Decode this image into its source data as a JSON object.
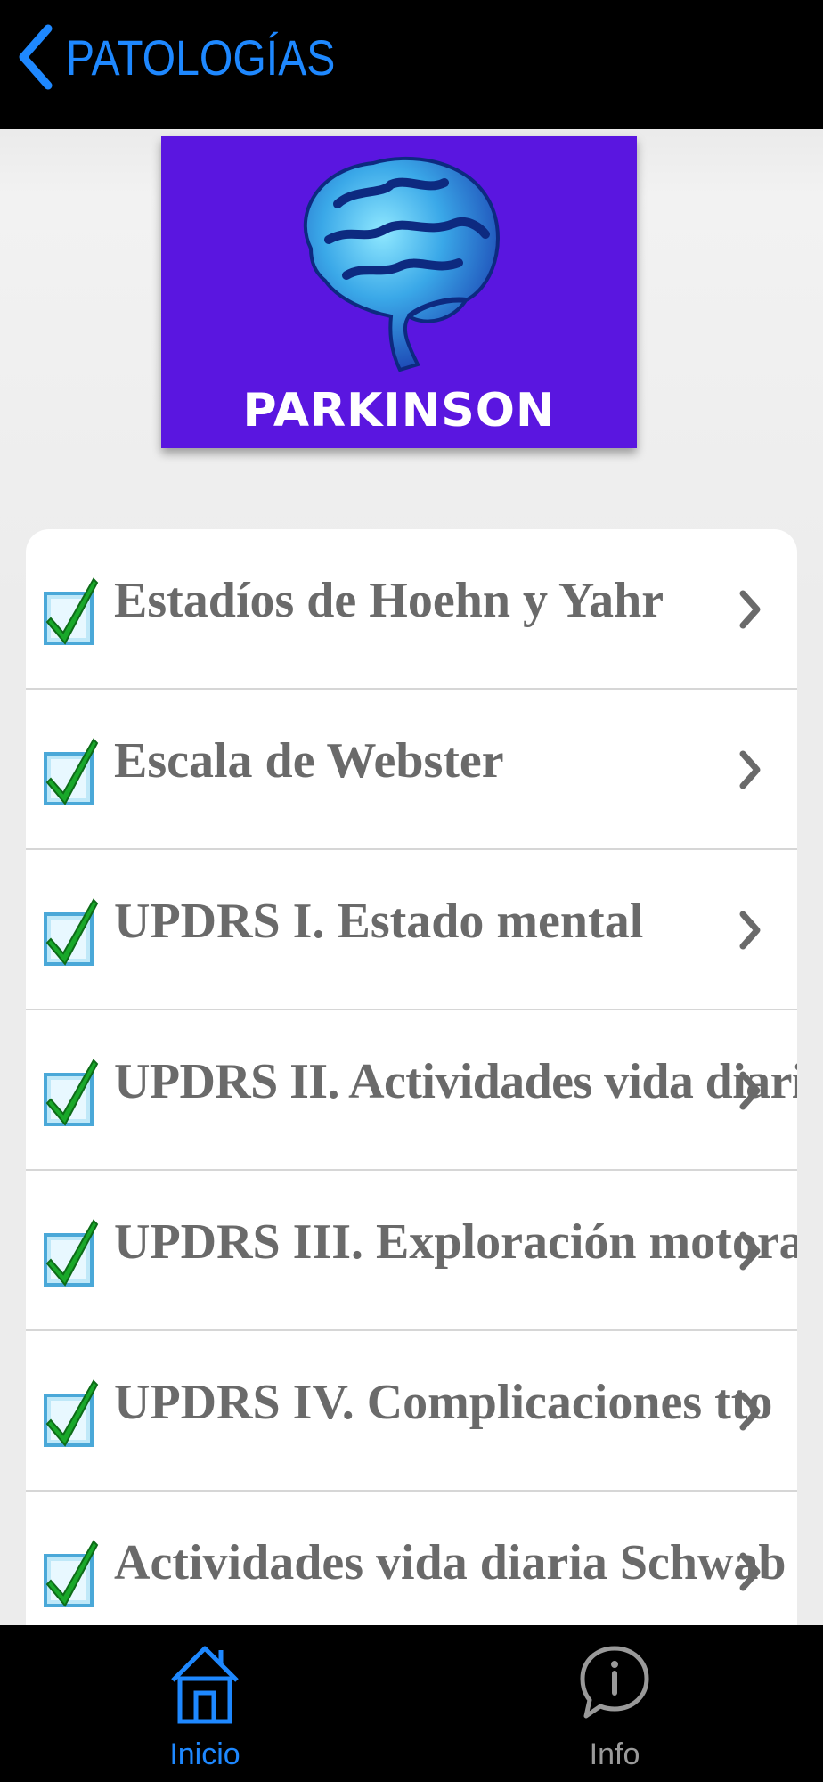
{
  "navbar": {
    "back_label": "PATOLOGÍAS",
    "accent_color": "#1e88ff",
    "background_color": "#000000"
  },
  "banner": {
    "title": "PARKINSON",
    "background_color": "#5a16e0",
    "icon": "brain-icon"
  },
  "list": {
    "items": [
      {
        "label": "Estadíos de Hoehn y Yahr",
        "icon": "checkbox-checked-icon"
      },
      {
        "label": "Escala de Webster",
        "icon": "checkbox-checked-icon"
      },
      {
        "label": "UPDRS I. Estado mental",
        "icon": "checkbox-checked-icon"
      },
      {
        "label": "UPDRS II. Actividades vida diaria",
        "icon": "checkbox-checked-icon"
      },
      {
        "label": "UPDRS III. Exploración motora",
        "icon": "checkbox-checked-icon"
      },
      {
        "label": "UPDRS IV. Complicaciones tto",
        "icon": "checkbox-checked-icon"
      },
      {
        "label": "Actividades vida diaria Schwab",
        "icon": "checkbox-checked-icon"
      }
    ]
  },
  "tabbar": {
    "tabs": [
      {
        "label": "Inicio",
        "icon": "home-icon",
        "active": true
      },
      {
        "label": "Info",
        "icon": "info-icon",
        "active": false
      }
    ]
  }
}
